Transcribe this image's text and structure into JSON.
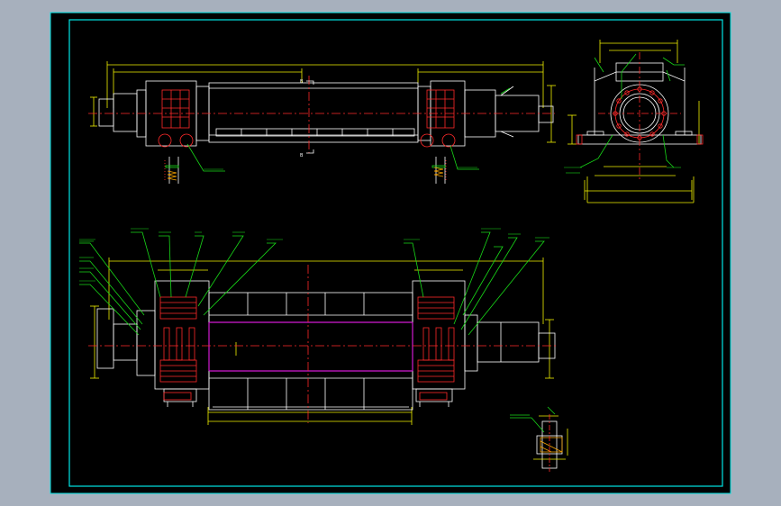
{
  "colors": {
    "background": "#a7b0bd",
    "sheet": "#000000",
    "border": "#00e5e5",
    "outline": "#ffffff",
    "dimension": "#f2f200",
    "centerline": "#ff2a2a",
    "leader": "#18d818",
    "section": "#d21ad2"
  },
  "labels": {
    "section_top": "B",
    "section_bottom": "B"
  }
}
